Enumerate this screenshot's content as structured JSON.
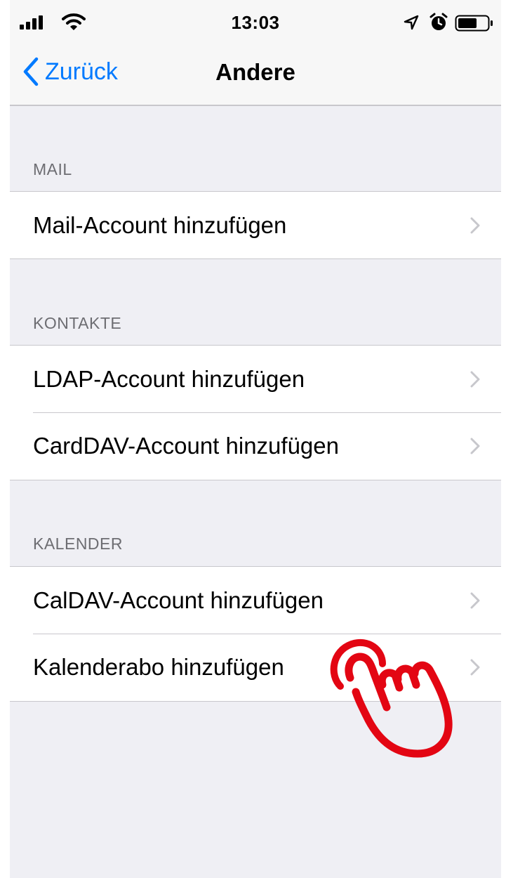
{
  "status_bar": {
    "time": "13:03",
    "signal_icon": "cellular-signal-icon",
    "wifi_icon": "wifi-icon",
    "location_icon": "location-arrow-icon",
    "alarm_icon": "alarm-clock-icon",
    "battery_icon": "battery-icon"
  },
  "nav": {
    "back_label": "Zurück",
    "title": "Andere"
  },
  "sections": {
    "mail": {
      "header": "MAIL",
      "items": [
        {
          "label": "Mail-Account hinzufügen"
        }
      ]
    },
    "kontakte": {
      "header": "KONTAKTE",
      "items": [
        {
          "label": "LDAP-Account hinzufügen"
        },
        {
          "label": "CardDAV-Account hinzufügen"
        }
      ]
    },
    "kalender": {
      "header": "KALENDER",
      "items": [
        {
          "label": "CalDAV-Account hinzufügen"
        },
        {
          "label": "Kalenderabo hinzufügen"
        }
      ]
    }
  },
  "colors": {
    "accent": "#007aff",
    "background": "#efeff4",
    "hand_annotation": "#e30613"
  }
}
